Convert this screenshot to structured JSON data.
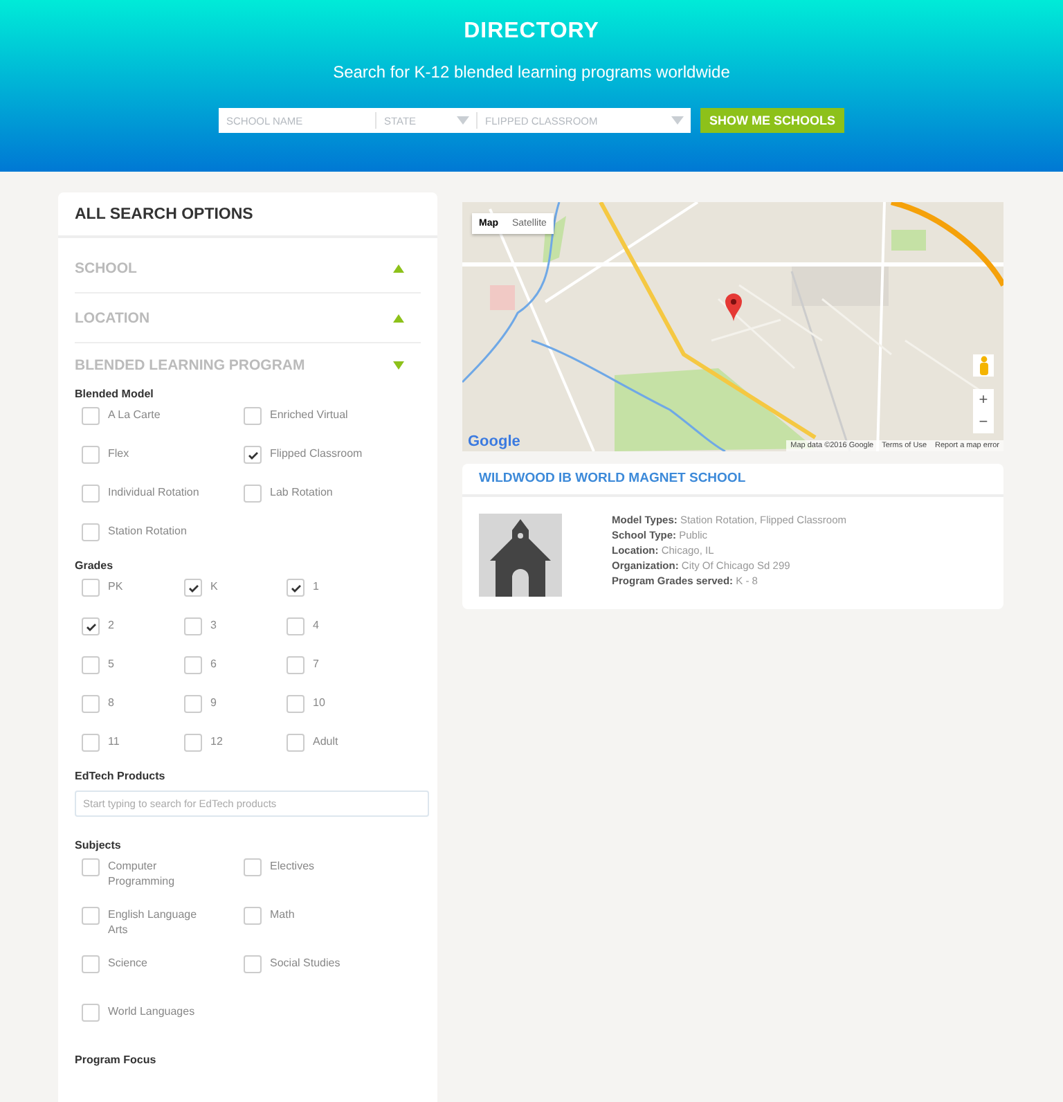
{
  "header": {
    "title": "DIRECTORY",
    "subtitle": "Search for K-12 blended learning programs worldwide"
  },
  "search": {
    "school_name": {
      "placeholder": "SCHOOL NAME"
    },
    "state": {
      "placeholder": "STATE"
    },
    "model": {
      "value": "FLIPPED CLASSROOM"
    },
    "button": "SHOW ME SCHOOLS"
  },
  "filters": {
    "title": "ALL SEARCH OPTIONS",
    "sections": [
      {
        "label": "SCHOOL",
        "expanded": false
      },
      {
        "label": "LOCATION",
        "expanded": false
      },
      {
        "label": "BLENDED LEARNING PROGRAM",
        "expanded": true
      }
    ],
    "groups": [
      {
        "title": "Blended Model",
        "kind": "wide",
        "options": [
          {
            "label": "A La Carte",
            "checked": false
          },
          {
            "label": "Enriched Virtual",
            "checked": false
          },
          {
            "label": "Flex",
            "checked": false
          },
          {
            "label": "Flipped Classroom",
            "checked": true
          },
          {
            "label": "Individual Rotation",
            "checked": false
          },
          {
            "label": "Lab Rotation",
            "checked": false
          },
          {
            "label": "Station Rotation",
            "checked": false
          }
        ]
      },
      {
        "title": "Grades",
        "kind": "narrow",
        "options": [
          {
            "label": "PK",
            "checked": false
          },
          {
            "label": "K",
            "checked": true
          },
          {
            "label": "1",
            "checked": true
          },
          {
            "label": "2",
            "checked": true
          },
          {
            "label": "3",
            "checked": false
          },
          {
            "label": "4",
            "checked": false
          },
          {
            "label": "5",
            "checked": false
          },
          {
            "label": "6",
            "checked": false
          },
          {
            "label": "7",
            "checked": false
          },
          {
            "label": "8",
            "checked": false
          },
          {
            "label": "9",
            "checked": false
          },
          {
            "label": "10",
            "checked": false
          },
          {
            "label": "11",
            "checked": false
          },
          {
            "label": "12",
            "checked": false
          },
          {
            "label": "Adult",
            "checked": false
          }
        ]
      },
      {
        "title": "EdTech Products",
        "kind": "search",
        "placeholder": "Start typing to search for EdTech products"
      },
      {
        "title": "Subjects",
        "kind": "tall",
        "options": [
          {
            "label": "Computer Programming",
            "checked": false
          },
          {
            "label": "Electives",
            "checked": false
          },
          {
            "label": "English Language Arts",
            "checked": false
          },
          {
            "label": "Math",
            "checked": false
          },
          {
            "label": "Science",
            "checked": false
          },
          {
            "label": "Social Studies",
            "checked": false
          },
          {
            "label": "World Languages",
            "checked": false
          }
        ]
      },
      {
        "title": "Program Focus",
        "kind": "tall"
      }
    ]
  },
  "map": {
    "tabs": [
      {
        "label": "Map",
        "selected": true
      },
      {
        "label": "Satellite",
        "selected": false
      }
    ],
    "zoom_in": "+",
    "zoom_out": "−",
    "logo": "Google",
    "attribution": [
      "Map data ©2016 Google",
      "Terms of Use",
      "Report a map error"
    ]
  },
  "result": {
    "name": "WILDWOOD IB WORLD MAGNET SCHOOL",
    "details": [
      "**Model Types:** Station Rotation, Flipped Classroom",
      "**School Type:** Public",
      "**Location:** Chicago, IL",
      "**Organization:** City Of Chicago Sd 299",
      "**Program Grades served:** K - 8"
    ]
  }
}
